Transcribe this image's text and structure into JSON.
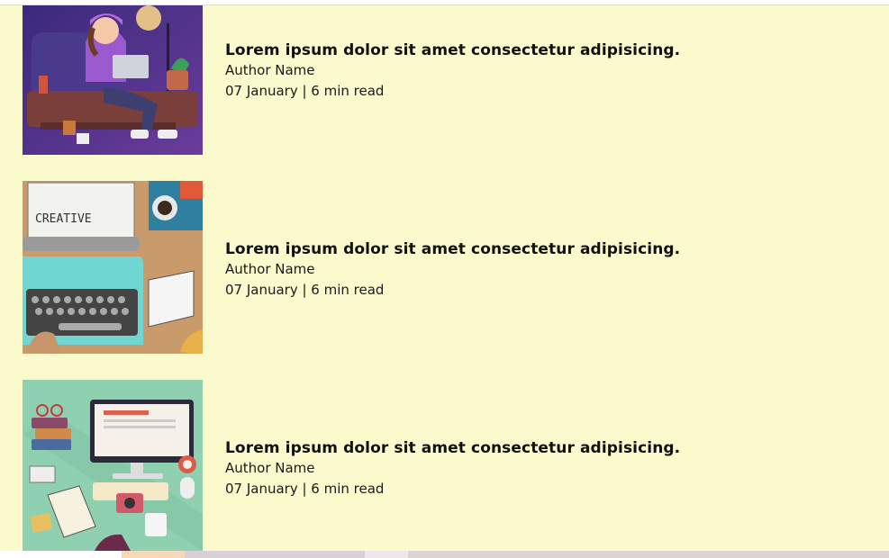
{
  "posts": [
    {
      "title": "Lorem ipsum dolor sit amet consectetur adipisicing.",
      "author": "Author Name",
      "date_line": "07 January | 6 min read",
      "image": "girl-with-laptop-illustration"
    },
    {
      "title": "Lorem ipsum dolor sit amet consectetur adipisicing.",
      "author": "Author Name",
      "date_line": "07 January | 6 min read",
      "image": "typewriter-creative-illustration",
      "image_text": "CREATIVE"
    },
    {
      "title": "Lorem ipsum dolor sit amet consectetur adipisicing.",
      "author": "Author Name",
      "date_line": "07 January | 6 min read",
      "image": "desk-workspace-illustration"
    }
  ],
  "colors": {
    "panel_background": "#fafacd",
    "text": "#111111"
  }
}
